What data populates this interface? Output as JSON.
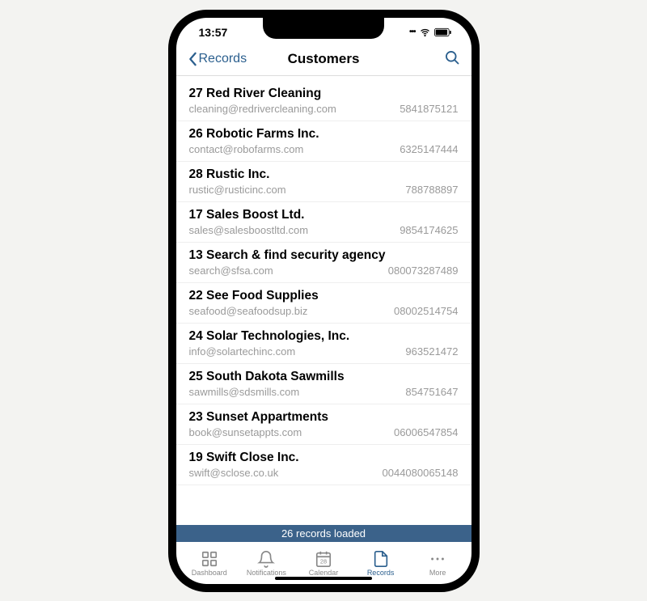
{
  "status": {
    "time": "13:57"
  },
  "nav": {
    "back_label": "Records",
    "title": "Customers"
  },
  "customers": [
    {
      "title": "27 Red River Cleaning",
      "email": "cleaning@redrivercleaning.com",
      "phone": "5841875121"
    },
    {
      "title": "26 Robotic Farms Inc.",
      "email": "contact@robofarms.com",
      "phone": "6325147444"
    },
    {
      "title": "28 Rustic Inc.",
      "email": "rustic@rusticinc.com",
      "phone": "788788897"
    },
    {
      "title": "17 Sales Boost Ltd.",
      "email": "sales@salesboostltd.com",
      "phone": "9854174625"
    },
    {
      "title": "13 Search & find security agency",
      "email": "search@sfsa.com",
      "phone": "080073287489"
    },
    {
      "title": "22 See Food Supplies",
      "email": "seafood@seafoodsup.biz",
      "phone": "08002514754"
    },
    {
      "title": "24 Solar Technologies, Inc.",
      "email": "info@solartechinc.com",
      "phone": "963521472"
    },
    {
      "title": "25 South Dakota Sawmills",
      "email": "sawmills@sdsmills.com",
      "phone": "854751647"
    },
    {
      "title": "23 Sunset Appartments",
      "email": "book@sunsetappts.com",
      "phone": "06006547854"
    },
    {
      "title": "19 Swift Close Inc.",
      "email": "swift@sclose.co.uk",
      "phone": "0044080065148"
    }
  ],
  "banner": "26 records loaded",
  "tabs": {
    "dashboard": "Dashboard",
    "notifications": "Notifications",
    "calendar": "Calendar",
    "calendar_day": "28",
    "records": "Records",
    "more": "More"
  }
}
